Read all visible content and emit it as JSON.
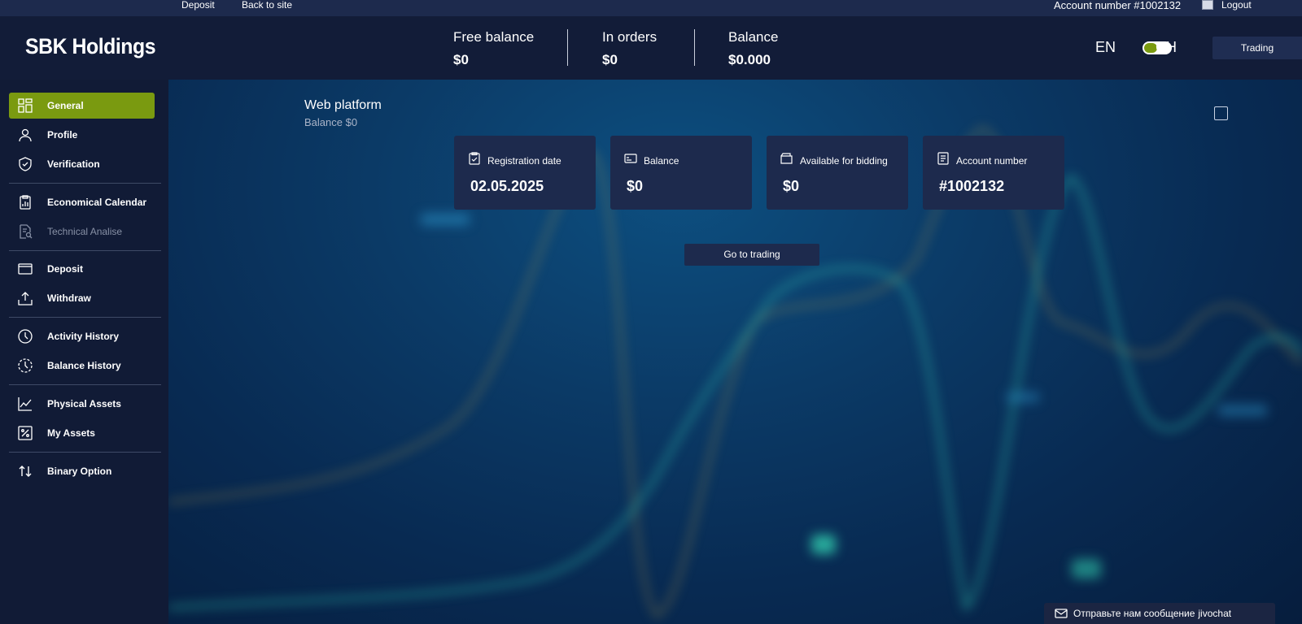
{
  "topbar": {
    "deposit_link": "Deposit",
    "back_link": "Back to site",
    "account_text": "Account number #1002132",
    "logout_link": "Logout"
  },
  "header": {
    "logo": "SBK Holdings",
    "stats": [
      {
        "label": "Free balance",
        "value": "$0"
      },
      {
        "label": "In orders",
        "value": "$0"
      },
      {
        "label": "Balance",
        "value": "$0.000"
      }
    ],
    "lang_left": "EN",
    "lang_right": "CH",
    "trading_button": "Trading"
  },
  "sidebar": {
    "items": [
      {
        "label": "General",
        "icon": "grid-icon"
      },
      {
        "label": "Profile",
        "icon": "user-icon"
      },
      {
        "label": "Verification",
        "icon": "shield-check-icon"
      },
      {
        "label": "Economical Calendar",
        "icon": "clipboard-chart-icon"
      },
      {
        "label": "Technical Analise",
        "icon": "document-search-icon"
      },
      {
        "label": "Deposit",
        "icon": "wallet-icon"
      },
      {
        "label": "Withdraw",
        "icon": "upload-icon"
      },
      {
        "label": "Activity History",
        "icon": "clock-icon"
      },
      {
        "label": "Balance History",
        "icon": "clock-dashed-icon"
      },
      {
        "label": "Physical Assets",
        "icon": "line-chart-icon"
      },
      {
        "label": "My Assets",
        "icon": "percent-icon"
      },
      {
        "label": "Binary Option",
        "icon": "arrows-updown-icon"
      }
    ]
  },
  "main": {
    "title": "Web platform",
    "subtitle": "Balance $0",
    "cards": [
      {
        "label": "Registration date",
        "value": "02.05.2025",
        "icon": "calendar-check-icon"
      },
      {
        "label": "Balance",
        "value": "$0",
        "icon": "card-icon"
      },
      {
        "label": "Available for bidding",
        "value": "$0",
        "icon": "wallet-icon"
      },
      {
        "label": "Account number",
        "value": "#1002132",
        "icon": "receipt-icon"
      }
    ],
    "go_button": "Go to trading"
  },
  "chat": {
    "message": "Отправьте нам сообщение",
    "brand": "jivochat"
  },
  "colors": {
    "accent": "#7a9a10",
    "sidebar_bg": "#111b36",
    "header_bg": "#121c38",
    "card_bg": "#1d2a4d"
  }
}
